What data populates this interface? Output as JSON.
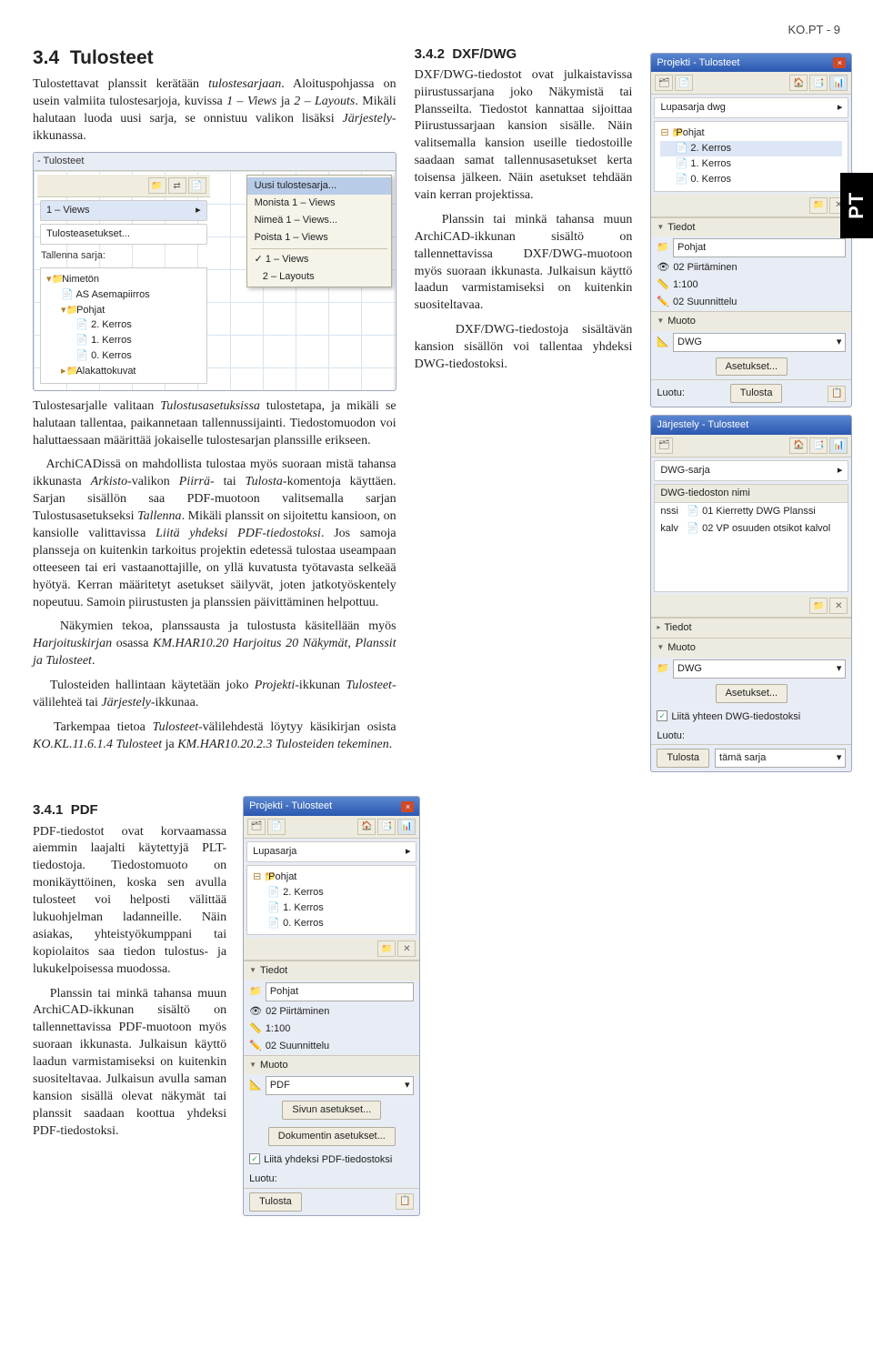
{
  "page_header": "KO.PT - 9",
  "side_tab": "PT",
  "sec34": {
    "num": "3.4",
    "title": "Tulosteet",
    "para1_a": "Tulostettavat planssit kerätään ",
    "para1_i1": "tulostesarjaan",
    "para1_b": ". Aloituspohjassa on usein valmiita tulostesarjoja, kuvissa ",
    "para1_i2": "1 – Views",
    "para1_c": " ja ",
    "para1_i3": "2 – Layouts",
    "para1_d": ". Mikäli halutaan luoda uusi sarja, se onnistuu valikon lisäksi ",
    "para1_i4": "Järjestely",
    "para1_e": "-ikkunassa.",
    "para2_a": "Tulostesarjalle valitaan ",
    "para2_i1": "Tulostusasetuksissa",
    "para2_b": " tulostetapa, ja mikäli se halutaan tallentaa, paikannetaan tallennussijainti. Tiedostomuodon voi haluttaessaan määrittää jokaiselle tulostesarjan planssille erikseen.",
    "para3_a": "ArchiCADissä on mahdollista tulostaa myös suoraan mistä tahansa ikkunasta ",
    "para3_i1": "Arkisto",
    "para3_b": "-valikon ",
    "para3_i2": "Piirrä",
    "para3_c": "- tai ",
    "para3_i3": "Tulosta",
    "para3_d": "-komentoja käyttäen. Sarjan sisällön saa PDF-muotoon valitsemalla sarjan Tulostusasetukseksi ",
    "para3_i4": "Tallenna",
    "para3_e": ". Mikäli planssit on sijoitettu kansioon, on kansiolle valittavissa ",
    "para3_i5": "Liitä yhdeksi PDF-tiedostoksi",
    "para3_f": ". Jos samoja plansseja on kuitenkin tarkoitus projektin edetessä tulostaa useampaan otteeseen tai eri vastaanottajille, on yllä kuvatusta työtavasta selkeää hyötyä. Kerran määritetyt asetukset säilyvät, joten jatkotyöskentely nopeutuu. Samoin piirustusten ja planssien päivittäminen helpottuu.",
    "para4_a": "Näkymien tekoa, planssausta ja tulostusta käsitellään myös ",
    "para4_i1": "Harjoituskirjan",
    "para4_b": " osassa ",
    "para4_i2": "KM.HAR10.20 Harjoitus 20 Näkymät, Planssit ja Tulosteet",
    "para4_c": ".",
    "para5_a": "Tulosteiden hallintaan käytetään joko ",
    "para5_i1": "Projekti",
    "para5_b": "-ikkunan ",
    "para5_i2": "Tulosteet",
    "para5_c": "-välilehteä tai ",
    "para5_i3": "Järjestely",
    "para5_d": "-ikkunaa.",
    "para6_a": "Tarkempaa tietoa ",
    "para6_i1": "Tulosteet",
    "para6_b": "-välilehdestä löytyy käsikirjan osista ",
    "para6_i2": "KO.KL.11.6.1.4 Tulosteet",
    "para6_c": " ja ",
    "para6_i3": "KM.HAR10.20.2.3 Tulosteiden tekeminen",
    "para6_d": "."
  },
  "sec341": {
    "num": "3.4.1",
    "title": "PDF",
    "para1": "PDF-tiedostot ovat korvaamassa aiemmin laajalti käytettyjä PLT-tiedostoja. Tiedostomuoto on monikäyttöinen, koska sen avulla tulosteet voi helposti välittää lukuohjelman ladanneille. Näin asiakas, yhteistyökumppani tai kopiolaitos saa tiedon tulostus- ja lukukelpoisessa muodossa.",
    "para2": "Planssin tai minkä tahansa muun ArchiCAD-ikkunan sisältö on tallennettavissa PDF-muotoon myös suoraan ikkunasta. Julkaisun käyttö laadun varmistamiseksi on kuitenkin suositeltavaa. Julkaisun avulla saman kansion sisällä olevat näkymät tai planssit saadaan koottua yhdeksi PDF-tiedostoksi."
  },
  "sec342": {
    "num": "3.4.2",
    "title": "DXF/DWG",
    "para1": "DXF/DWG-tiedostot ovat julkaistavissa piirustussarjana joko Näkymistä tai Plansseilta. Tiedostot kannattaa sijoittaa Piirustussarjaan kansion sisälle. Näin valitsemalla kansion useille tiedostoille saadaan samat tallennusasetukset kerta toisensa jälkeen. Näin asetukset tehdään vain kerran projektissa.",
    "para2": "Planssin tai minkä tahansa muun ArchiCAD-ikkunan sisältö on tallennettavissa DXF/DWG-muotoon myös suoraan ikkunasta. Julkaisun käyttö laadun varmistamiseksi on kuitenkin suositeltavaa.",
    "para3": "DXF/DWG-tiedostoja sisältävän kansion sisällön voi tallentaa yhdeksi DWG-tiedostoksi."
  },
  "mock1": {
    "title": "Tulosteet",
    "row1": "1 – Views",
    "row2": "Tulosteasetukset...",
    "save_label": "Tallenna sarja:",
    "menu": {
      "m1": "Uusi tulostesarja...",
      "m2": "Monista 1 – Views",
      "m3": "Nimeä 1 – Views...",
      "m4": "Poista 1 – Views",
      "m5": "1 – Views",
      "m6": "2 – Layouts"
    },
    "tree": {
      "t1": "Nimetön",
      "t2": "AS Asemapiirros",
      "t3": "Pohjat",
      "t4": "2. Kerros",
      "t5": "1. Kerros",
      "t6": "0. Kerros",
      "t7": "Alakattokuvat"
    }
  },
  "mock_pdf": {
    "title": "Projekti - Tulosteet",
    "set": "Lupasarja",
    "tree": {
      "t1": "Pohjat",
      "t2": "2. Kerros",
      "t3": "1. Kerros",
      "t4": "0. Kerros"
    },
    "tiedot": "Tiedot",
    "pohjat": "Pohjat",
    "piirt": "02 Piirtäminen",
    "scale": "1:100",
    "suun": "02 Suunnittelu",
    "muoto": "Muoto",
    "format": "PDF",
    "btn1": "Sivun asetukset...",
    "btn2": "Dokumentin asetukset...",
    "chk": "Liitä yhdeksi PDF-tiedostoksi",
    "luotu": "Luotu:",
    "tulosta": "Tulosta"
  },
  "mock_dwg_top": {
    "title": "Projekti - Tulosteet",
    "set": "Lupasarja dwg",
    "tree": {
      "t1": "Pohjat",
      "t2": "2. Kerros",
      "t3": "1. Kerros",
      "t4": "0. Kerros"
    },
    "tiedot": "Tiedot",
    "pohjat": "Pohjat",
    "piirt": "02 Piirtäminen",
    "scale": "1:100",
    "suun": "02 Suunnittelu",
    "muoto": "Muoto",
    "format": "DWG",
    "aset": "Asetukset...",
    "luotu": "Luotu:",
    "tulosta": "Tulosta"
  },
  "mock_dwg_bot": {
    "title": "Järjestely - Tulosteet",
    "set": "DWG-sarja",
    "col": "DWG-tiedoston nimi",
    "r1": "01 Kierretty DWG Planssi",
    "r2": "02 VP osuuden otsikot kalvol",
    "tiedot": "Tiedot",
    "muoto": "Muoto",
    "format": "DWG",
    "aset": "Asetukset...",
    "chk": "Liitä yhteen DWG-tiedostoksi",
    "luotu": "Luotu:",
    "tulosta": "Tulosta",
    "scope": "tämä sarja"
  }
}
